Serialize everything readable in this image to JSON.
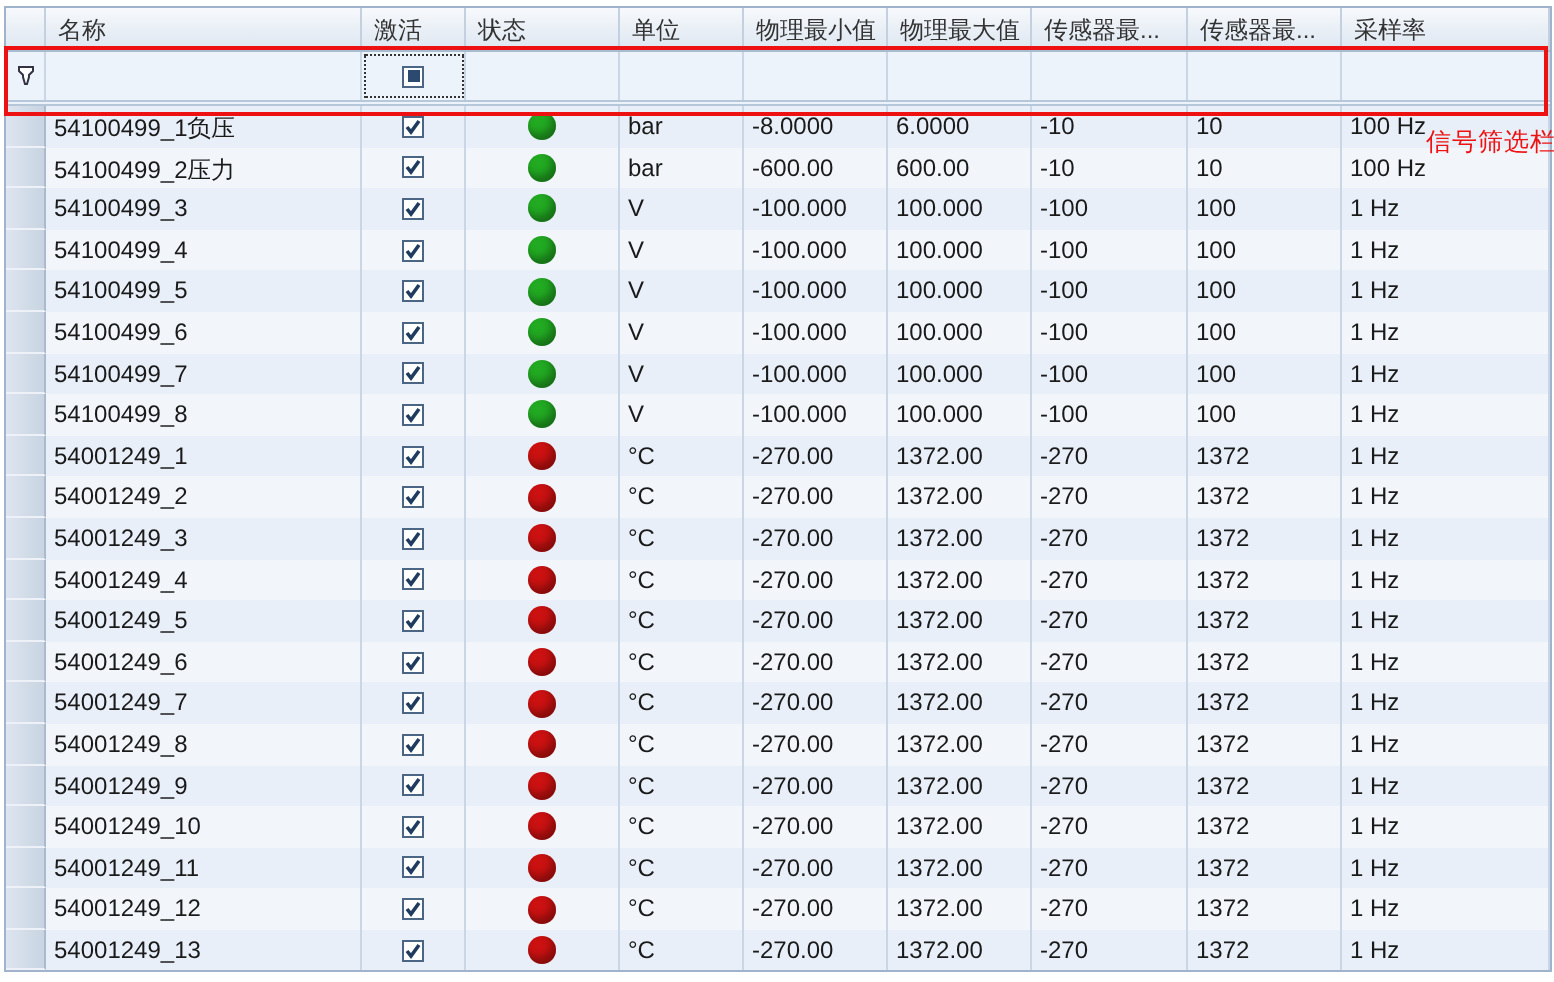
{
  "table": {
    "columns": [
      "名称",
      "激活",
      "状态",
      "单位",
      "物理最小值",
      "物理最大值",
      "传感器最...",
      "传感器最...",
      "采样率"
    ],
    "filter_row": {
      "active_filter": {
        "indeterminate": true,
        "focused": true
      }
    },
    "rows": [
      {
        "name": "54100499_1负压",
        "active": true,
        "color": "#22aa22",
        "unit": "bar",
        "min": "-8.0000",
        "max": "6.0000",
        "sensor_min": "-10",
        "sensor_max": "10",
        "rate": "100 Hz"
      },
      {
        "name": "54100499_2压力",
        "active": true,
        "color": "#22aa22",
        "unit": "bar",
        "min": "-600.00",
        "max": "600.00",
        "sensor_min": "-10",
        "sensor_max": "10",
        "rate": "100 Hz"
      },
      {
        "name": "54100499_3",
        "active": true,
        "color": "#22aa22",
        "unit": "V",
        "min": "-100.000",
        "max": "100.000",
        "sensor_min": "-100",
        "sensor_max": "100",
        "rate": "1 Hz"
      },
      {
        "name": "54100499_4",
        "active": true,
        "color": "#22aa22",
        "unit": "V",
        "min": "-100.000",
        "max": "100.000",
        "sensor_min": "-100",
        "sensor_max": "100",
        "rate": "1 Hz"
      },
      {
        "name": "54100499_5",
        "active": true,
        "color": "#22aa22",
        "unit": "V",
        "min": "-100.000",
        "max": "100.000",
        "sensor_min": "-100",
        "sensor_max": "100",
        "rate": "1 Hz"
      },
      {
        "name": "54100499_6",
        "active": true,
        "color": "#22aa22",
        "unit": "V",
        "min": "-100.000",
        "max": "100.000",
        "sensor_min": "-100",
        "sensor_max": "100",
        "rate": "1 Hz"
      },
      {
        "name": "54100499_7",
        "active": true,
        "color": "#22aa22",
        "unit": "V",
        "min": "-100.000",
        "max": "100.000",
        "sensor_min": "-100",
        "sensor_max": "100",
        "rate": "1 Hz"
      },
      {
        "name": "54100499_8",
        "active": true,
        "color": "#22aa22",
        "unit": "V",
        "min": "-100.000",
        "max": "100.000",
        "sensor_min": "-100",
        "sensor_max": "100",
        "rate": "1 Hz"
      },
      {
        "name": "54001249_1",
        "active": true,
        "color": "#cc1111",
        "unit": "°C",
        "min": "-270.00",
        "max": "1372.00",
        "sensor_min": "-270",
        "sensor_max": "1372",
        "rate": "1 Hz"
      },
      {
        "name": "54001249_2",
        "active": true,
        "color": "#cc1111",
        "unit": "°C",
        "min": "-270.00",
        "max": "1372.00",
        "sensor_min": "-270",
        "sensor_max": "1372",
        "rate": "1 Hz"
      },
      {
        "name": "54001249_3",
        "active": true,
        "color": "#cc1111",
        "unit": "°C",
        "min": "-270.00",
        "max": "1372.00",
        "sensor_min": "-270",
        "sensor_max": "1372",
        "rate": "1 Hz"
      },
      {
        "name": "54001249_4",
        "active": true,
        "color": "#cc1111",
        "unit": "°C",
        "min": "-270.00",
        "max": "1372.00",
        "sensor_min": "-270",
        "sensor_max": "1372",
        "rate": "1 Hz"
      },
      {
        "name": "54001249_5",
        "active": true,
        "color": "#cc1111",
        "unit": "°C",
        "min": "-270.00",
        "max": "1372.00",
        "sensor_min": "-270",
        "sensor_max": "1372",
        "rate": "1 Hz"
      },
      {
        "name": "54001249_6",
        "active": true,
        "color": "#cc1111",
        "unit": "°C",
        "min": "-270.00",
        "max": "1372.00",
        "sensor_min": "-270",
        "sensor_max": "1372",
        "rate": "1 Hz"
      },
      {
        "name": "54001249_7",
        "active": true,
        "color": "#cc1111",
        "unit": "°C",
        "min": "-270.00",
        "max": "1372.00",
        "sensor_min": "-270",
        "sensor_max": "1372",
        "rate": "1 Hz"
      },
      {
        "name": "54001249_8",
        "active": true,
        "color": "#cc1111",
        "unit": "°C",
        "min": "-270.00",
        "max": "1372.00",
        "sensor_min": "-270",
        "sensor_max": "1372",
        "rate": "1 Hz"
      },
      {
        "name": "54001249_9",
        "active": true,
        "color": "#cc1111",
        "unit": "°C",
        "min": "-270.00",
        "max": "1372.00",
        "sensor_min": "-270",
        "sensor_max": "1372",
        "rate": "1 Hz"
      },
      {
        "name": "54001249_10",
        "active": true,
        "color": "#cc1111",
        "unit": "°C",
        "min": "-270.00",
        "max": "1372.00",
        "sensor_min": "-270",
        "sensor_max": "1372",
        "rate": "1 Hz"
      },
      {
        "name": "54001249_11",
        "active": true,
        "color": "#cc1111",
        "unit": "°C",
        "min": "-270.00",
        "max": "1372.00",
        "sensor_min": "-270",
        "sensor_max": "1372",
        "rate": "1 Hz"
      },
      {
        "name": "54001249_12",
        "active": true,
        "color": "#cc1111",
        "unit": "°C",
        "min": "-270.00",
        "max": "1372.00",
        "sensor_min": "-270",
        "sensor_max": "1372",
        "rate": "1 Hz"
      },
      {
        "name": "54001249_13",
        "active": true,
        "color": "#cc1111",
        "unit": "°C",
        "min": "-270.00",
        "max": "1372.00",
        "sensor_min": "-270",
        "sensor_max": "1372",
        "rate": "1 Hz"
      }
    ]
  },
  "annotation": {
    "label": "信号筛选栏"
  }
}
